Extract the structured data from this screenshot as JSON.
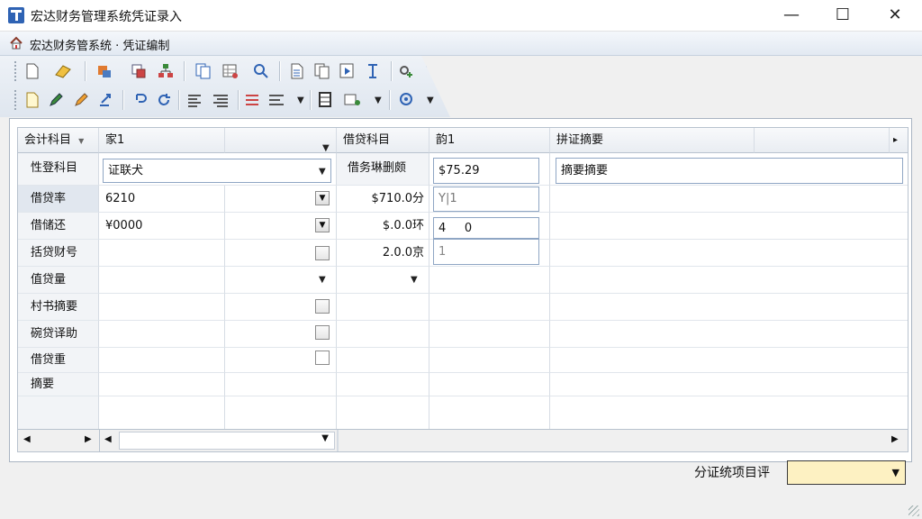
{
  "window": {
    "title": "宏达财务管理系统凭证录入"
  },
  "nav": {
    "text": "宏达财务管系统 · 凭证编制"
  },
  "toolbar": {
    "row1": [
      "new-doc",
      "eraser",
      "transfer",
      "copy-layout",
      "org",
      "duplicate",
      "grid-edit",
      "find",
      "page",
      "pages",
      "play-doc",
      "text-cursor",
      "link-add",
      "link-tool"
    ],
    "row2": [
      "note",
      "pen",
      "pencil",
      "export",
      "undo",
      "redo",
      "align-left",
      "align-right",
      "list-a",
      "list-b",
      "table",
      "calc",
      "settings"
    ]
  },
  "grid": {
    "headers": {
      "col1": "会计科目",
      "col2": "家1",
      "col3": "借贷科目",
      "col4": "韵1",
      "col5": "拼证摘要"
    },
    "row0": {
      "label": "性登科目",
      "combo_value": "证联犬",
      "mid_label": "借务琳删颇",
      "amount_value": "$75.29",
      "memo_value": "摘要摘要"
    },
    "rows": [
      {
        "label": "借贷率",
        "value": "6210",
        "amount": "$710.0分",
        "entry": "Y|1"
      },
      {
        "label": "借储还",
        "value": "¥0000",
        "amount": "$.0.0环",
        "entry": "4     0"
      },
      {
        "label": "括贷财号",
        "value": "",
        "amount": "2.0.0京",
        "entry": "1"
      },
      {
        "label": "值贷量",
        "value": "",
        "amount": "",
        "entry": ""
      },
      {
        "label": "村书摘要",
        "value": "",
        "amount": "",
        "entry": ""
      },
      {
        "label": "碗贷译助",
        "value": "",
        "amount": "",
        "entry": ""
      },
      {
        "label": "借贷重",
        "value": "",
        "amount": "",
        "entry": ""
      },
      {
        "label": "摘要",
        "value": "",
        "amount": "",
        "entry": ""
      }
    ]
  },
  "footer": {
    "label": "分证统项目评",
    "combo_value": ""
  },
  "colors": {
    "accent": "#2f63b4",
    "combo_bg": "#fdf1c2"
  }
}
